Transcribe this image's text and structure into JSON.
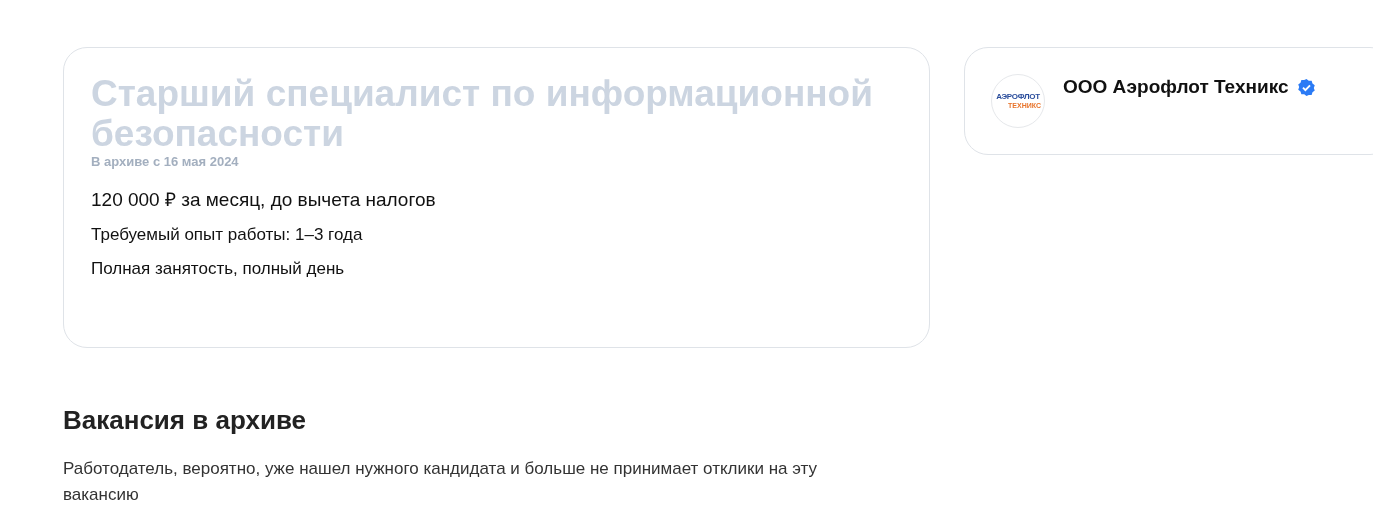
{
  "vacancy": {
    "title": "Старший специалист по информационной безопасности",
    "archived": true,
    "archive_note": "В архиве с 16 мая 2024",
    "salary": "120 000 ₽ за месяц, до вычета налогов",
    "experience": "Требуемый опыт работы: 1–3 года",
    "employment": "Полная занятость, полный день"
  },
  "employer": {
    "logo_lines": [
      "АЭРОФЛОТ",
      "ТЕХНИКС"
    ],
    "name": "ООО Аэрофлот Техникс",
    "verified": true
  },
  "archive_notice": {
    "heading": "Вакансия в архиве",
    "text": "Работодатель, вероятно, уже нашел нужного кандидата и больше не принимает отклики на эту вакансию"
  }
}
